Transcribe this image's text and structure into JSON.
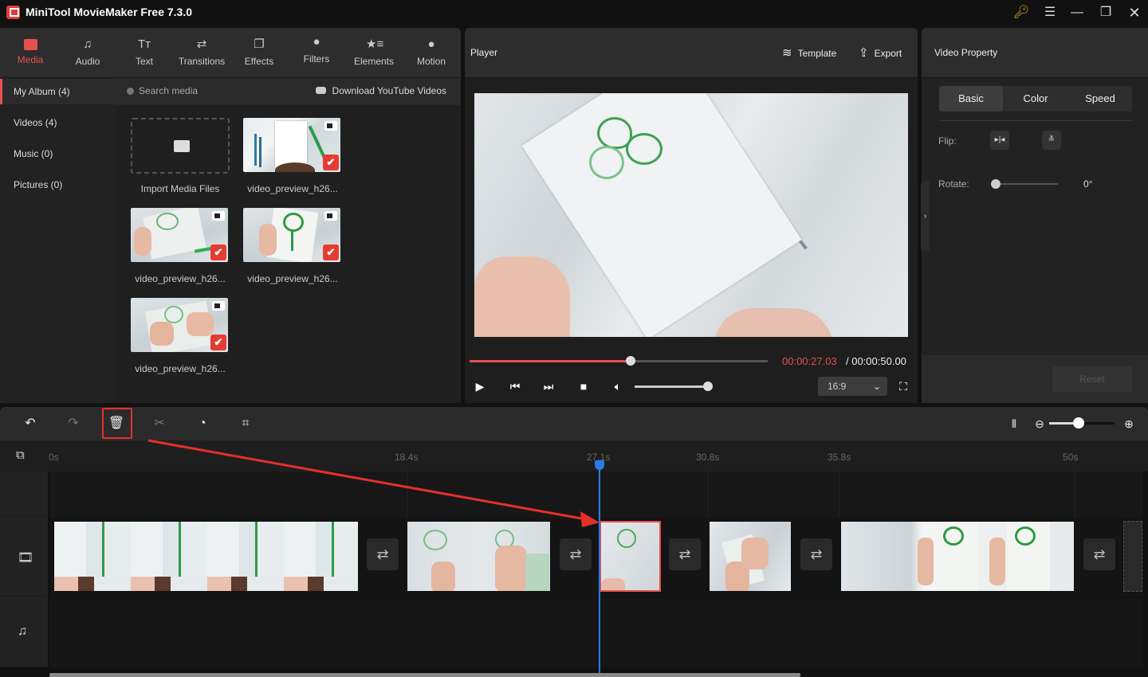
{
  "app": {
    "title": "MiniTool MovieMaker Free 7.3.0",
    "window_controls": [
      "key-icon",
      "menu-icon",
      "minimize-icon",
      "maximize-icon",
      "close-icon"
    ]
  },
  "top_toolbar": {
    "tools": [
      {
        "label": "Media",
        "icon": "folder-icon",
        "active": true
      },
      {
        "label": "Audio",
        "icon": "music-icon"
      },
      {
        "label": "Text",
        "icon": "text-icon"
      },
      {
        "label": "Transitions",
        "icon": "swap-icon"
      },
      {
        "label": "Effects",
        "icon": "effects-icon"
      },
      {
        "label": "Filters",
        "icon": "filters-icon"
      },
      {
        "label": "Elements",
        "icon": "elements-icon"
      },
      {
        "label": "Motion",
        "icon": "motion-icon"
      }
    ]
  },
  "album": {
    "items": [
      {
        "label": "My Album (4)",
        "active": true
      },
      {
        "label": "Videos (4)"
      },
      {
        "label": "Music (0)"
      },
      {
        "label": "Pictures (0)"
      }
    ]
  },
  "media": {
    "search_placeholder": "Search media",
    "download_label": "Download YouTube Videos",
    "import_label": "Import Media Files",
    "files": [
      {
        "name": "video_preview_h26...",
        "type": "video",
        "added": true
      },
      {
        "name": "video_preview_h26...",
        "type": "video",
        "added": true
      },
      {
        "name": "video_preview_h26...",
        "type": "video",
        "added": true
      },
      {
        "name": "video_preview_h26...",
        "type": "video",
        "added": true
      }
    ]
  },
  "player": {
    "title": "Player",
    "template_label": "Template",
    "export_label": "Export",
    "current_time": "00:00:27.03",
    "total_time": "/ 00:00:50.00",
    "progress_fraction": 0.54,
    "volume_fraction": 1.0,
    "aspect_ratio": "16:9",
    "accent": "#e5524d"
  },
  "property": {
    "title": "Video Property",
    "tabs": [
      {
        "label": "Basic",
        "active": true
      },
      {
        "label": "Color"
      },
      {
        "label": "Speed"
      }
    ],
    "flip_label": "Flip:",
    "rotate_label": "Rotate:",
    "rotate_value": "0°",
    "reset_label": "Reset"
  },
  "timeline": {
    "tools": [
      "undo-icon",
      "redo-icon",
      "delete-icon",
      "split-icon",
      "speed-icon",
      "crop-icon"
    ],
    "ticks": [
      {
        "label": "0s"
      },
      {
        "label": "18.4s"
      },
      {
        "label": "27.1s"
      },
      {
        "label": "30.8s"
      },
      {
        "label": "35.8s"
      },
      {
        "label": "50s"
      }
    ],
    "playhead_time": "27.1s",
    "zoom_fraction": 0.45,
    "playhead_color": "#2d7ae5",
    "highlight_color": "#e5302a",
    "transition_glyph": "⇄"
  }
}
